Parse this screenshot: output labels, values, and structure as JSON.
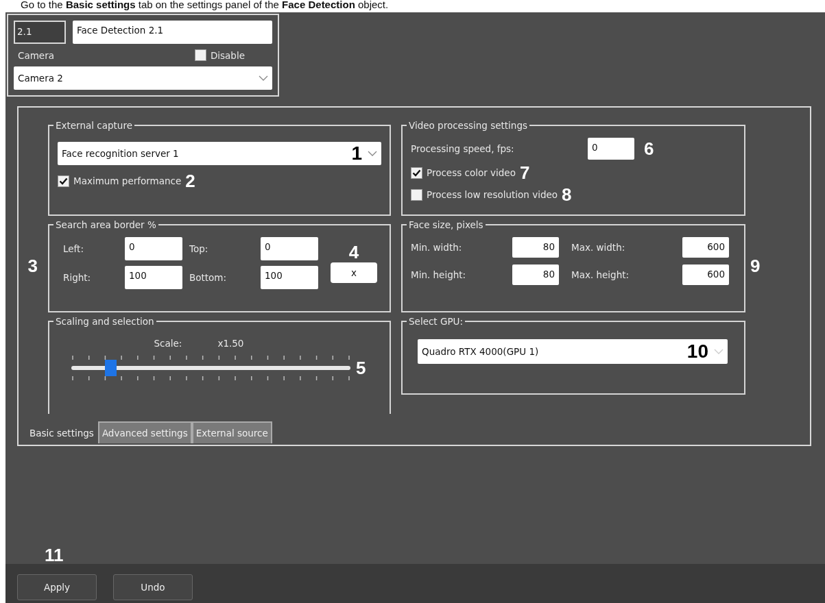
{
  "caption": "Go to the **Basic settings** tab on the settings panel of the **Face Detection** object.",
  "header": {
    "id": "2.1",
    "name": "Face Detection 2.1",
    "camera_label": "Camera",
    "disable": {
      "label": "Disable",
      "checked": false
    },
    "camera": "Camera 2"
  },
  "external_capture": {
    "title": "External capture",
    "server": "Face recognition server 1",
    "server_callout": "1",
    "max_performance": {
      "label": "Maximum performance",
      "checked": true,
      "callout": "2"
    }
  },
  "search_area": {
    "title": "Search area border %",
    "callout": "3",
    "fields": [
      {
        "label": "Left:",
        "value": "0"
      },
      {
        "label": "Top:",
        "value": "0"
      },
      {
        "label": "Right:",
        "value": "100"
      },
      {
        "label": "Bottom:",
        "value": "100"
      }
    ],
    "reset_button": "x",
    "reset_callout": "4"
  },
  "scaling": {
    "title": "Scaling and selection",
    "scale_label": "Scale:",
    "scale_value": "x1.50",
    "slider": {
      "level": 0.14
    },
    "callout": "5"
  },
  "video_processing": {
    "title": "Video processing settings",
    "speed_label": "Processing speed, fps:",
    "speed": "0",
    "speed_callout": "6",
    "checkboxes": [
      {
        "label": "Process color video",
        "checked": true,
        "callout": "7"
      },
      {
        "label": "Process low resolution video",
        "checked": false,
        "callout": "8"
      }
    ]
  },
  "face_size": {
    "title": "Face size, pixels",
    "callout": "9",
    "fields": [
      {
        "label": "Min. width:",
        "value": "80"
      },
      {
        "label": "Max. width:",
        "value": "600"
      },
      {
        "label": "Min. height:",
        "value": "80"
      },
      {
        "label": "Max. height:",
        "value": "600"
      }
    ]
  },
  "gpu": {
    "title": "Select GPU:",
    "value": "Quadro RTX 4000(GPU 1)",
    "callout": "10"
  },
  "tabs": [
    {
      "label": "Basic settings",
      "selected": true
    },
    {
      "label": "Advanced settings",
      "selected": false
    },
    {
      "label": "External source",
      "selected": false
    }
  ],
  "buttons": [
    {
      "label": "Apply",
      "callout": "11"
    },
    {
      "label": "Undo"
    }
  ]
}
